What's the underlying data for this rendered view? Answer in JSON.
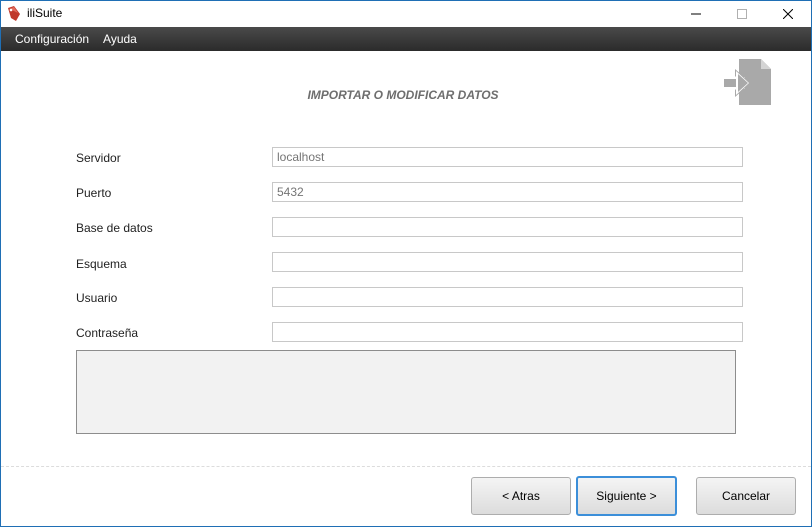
{
  "window": {
    "title": "iliSuite"
  },
  "menu": {
    "items": [
      {
        "label": "Configuración"
      },
      {
        "label": "Ayuda"
      }
    ]
  },
  "header": {
    "title": "IMPORTAR O MODIFICAR DATOS",
    "icon": "import-data-icon"
  },
  "form": {
    "fields": [
      {
        "label": "Servidor",
        "value": "",
        "placeholder": "localhost"
      },
      {
        "label": "Puerto",
        "value": "",
        "placeholder": "5432"
      },
      {
        "label": "Base de datos",
        "value": "",
        "placeholder": ""
      },
      {
        "label": "Esquema",
        "value": "",
        "placeholder": ""
      },
      {
        "label": "Usuario",
        "value": "",
        "placeholder": ""
      },
      {
        "label": "Contraseña",
        "value": "",
        "placeholder": ""
      }
    ],
    "log": ""
  },
  "buttons": {
    "back": "< Atras",
    "next": "Siguiente >",
    "cancel": "Cancelar"
  },
  "colors": {
    "menubar": "#2b2b2b",
    "accent": "#3c8fd9",
    "title_text": "#6e6e6e",
    "app_icon": "#c0392b"
  }
}
